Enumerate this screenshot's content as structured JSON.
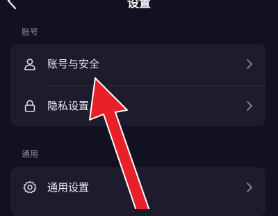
{
  "header": {
    "title": "设置"
  },
  "sections": [
    {
      "label": "账号",
      "items": [
        {
          "label": "账号与安全",
          "icon": "person-icon"
        },
        {
          "label": "隐私设置",
          "icon": "lock-icon"
        }
      ]
    },
    {
      "label": "通用",
      "items": [
        {
          "label": "通用设置",
          "icon": "gear-icon"
        }
      ]
    }
  ],
  "annotation": {
    "arrow_color": "#e8202a"
  },
  "colors": {
    "background": "#121121",
    "card": "#1d1c2d",
    "section_label": "#8f8fa0"
  }
}
